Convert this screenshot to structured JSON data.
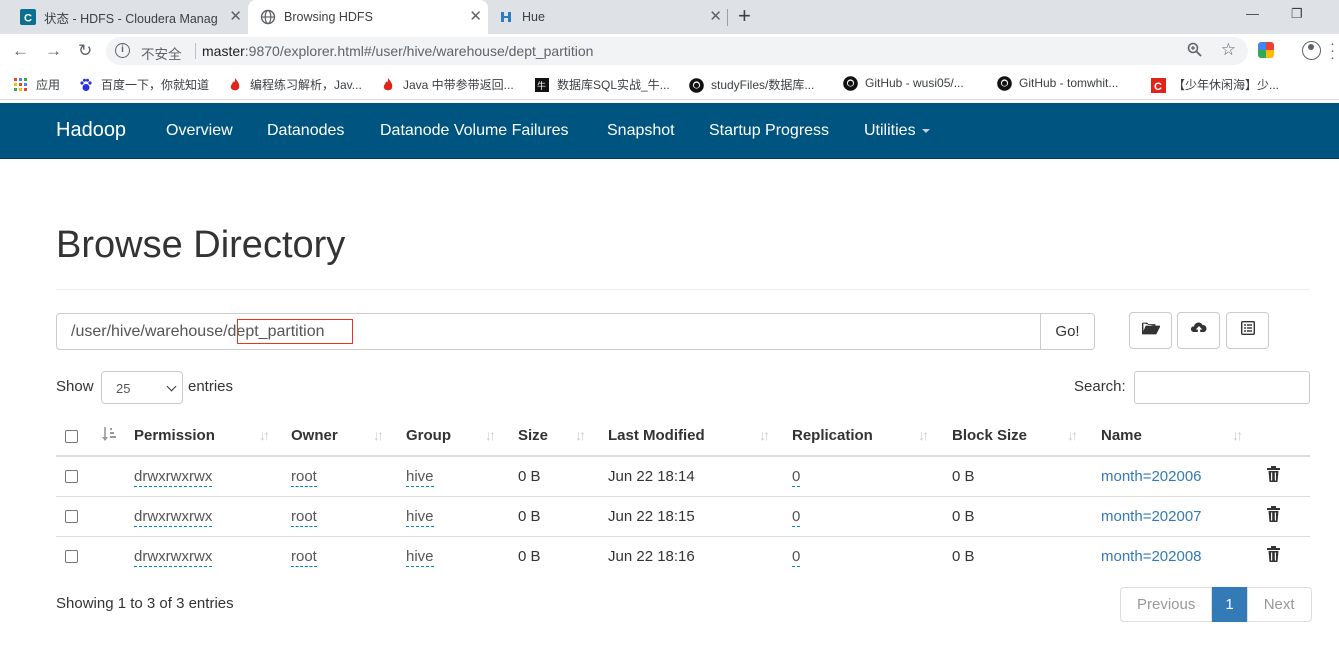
{
  "browser": {
    "tabs": [
      {
        "title": "状态 - HDFS - Cloudera Manag",
        "icon": "cloudera-icon"
      },
      {
        "title": "Browsing HDFS",
        "icon": "globe-icon"
      },
      {
        "title": "Hue",
        "icon": "hue-icon"
      }
    ],
    "security_label": "不安全",
    "url_host": "master",
    "url_rest": ":9870/explorer.html#/user/hive/warehouse/dept_partition",
    "bookmarks": [
      {
        "label": "应用",
        "icon": "apps-grid-icon"
      },
      {
        "label": "百度一下，你就知道",
        "icon": "baidu-paw-icon"
      },
      {
        "label": "编程练习解析，Jav...",
        "icon": "flame-icon"
      },
      {
        "label": "Java 中带参带返回...",
        "icon": "flame-icon"
      },
      {
        "label": "数据库SQL实战_牛...",
        "icon": "nowcoder-icon"
      },
      {
        "label": "studyFiles/数据库...",
        "icon": "github-icon"
      },
      {
        "label": "GitHub - wusi05/...",
        "icon": "github-icon"
      },
      {
        "label": "GitHub - tomwhit...",
        "icon": "github-icon"
      },
      {
        "label": "【少年休闲海】少...",
        "icon": "csdn-icon"
      }
    ]
  },
  "navbar": {
    "brand": "Hadoop",
    "links": [
      "Overview",
      "Datanodes",
      "Datanode Volume Failures",
      "Snapshot",
      "Startup Progress",
      "Utilities"
    ]
  },
  "page": {
    "title": "Browse Directory",
    "path_prefix": "/user/hive/warehouse/",
    "path_dir": "dept_partition",
    "go_label": "Go!",
    "show_label": "Show",
    "page_size": "25",
    "entries_label": "entries",
    "search_label": "Search:",
    "columns": [
      "Permission",
      "Owner",
      "Group",
      "Size",
      "Last Modified",
      "Replication",
      "Block Size",
      "Name"
    ],
    "rows": [
      {
        "permission": "drwxrwxrwx",
        "owner": "root",
        "group": "hive",
        "size": "0 B",
        "modified": "Jun 22 18:14",
        "replication": "0",
        "block_size": "0 B",
        "name": "month=202006"
      },
      {
        "permission": "drwxrwxrwx",
        "owner": "root",
        "group": "hive",
        "size": "0 B",
        "modified": "Jun 22 18:15",
        "replication": "0",
        "block_size": "0 B",
        "name": "month=202007"
      },
      {
        "permission": "drwxrwxrwx",
        "owner": "root",
        "group": "hive",
        "size": "0 B",
        "modified": "Jun 22 18:16",
        "replication": "0",
        "block_size": "0 B",
        "name": "month=202008"
      }
    ],
    "info": "Showing 1 to 3 of 3 entries",
    "pager": {
      "previous": "Previous",
      "current": "1",
      "next": "Next"
    }
  },
  "colors": {
    "navbar": "#005580",
    "link": "#337ab7",
    "highlight_box": "#e33322"
  }
}
